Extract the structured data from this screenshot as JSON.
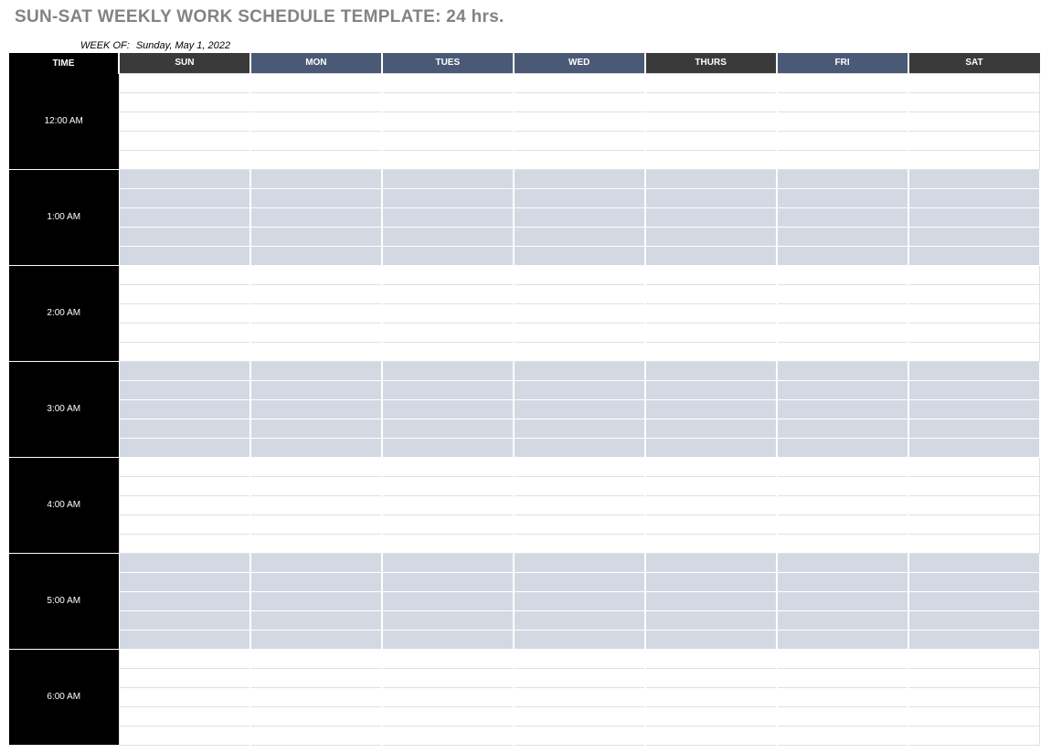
{
  "title": "SUN-SAT WEEKLY WORK SCHEDULE TEMPLATE: 24 hrs.",
  "weekof": {
    "label": "WEEK OF:",
    "date": "Sunday, May 1, 2022"
  },
  "headers": {
    "time": "TIME",
    "days": [
      "SUN",
      "MON",
      "TUES",
      "WED",
      "THURS",
      "FRI",
      "SAT"
    ]
  },
  "hours": [
    {
      "label": "12:00 AM",
      "shaded": false
    },
    {
      "label": "1:00 AM",
      "shaded": true
    },
    {
      "label": "2:00 AM",
      "shaded": false
    },
    {
      "label": "3:00 AM",
      "shaded": true
    },
    {
      "label": "4:00 AM",
      "shaded": false
    },
    {
      "label": "5:00 AM",
      "shaded": true
    },
    {
      "label": "6:00 AM",
      "shaded": false
    }
  ],
  "subrows_per_hour": 5
}
